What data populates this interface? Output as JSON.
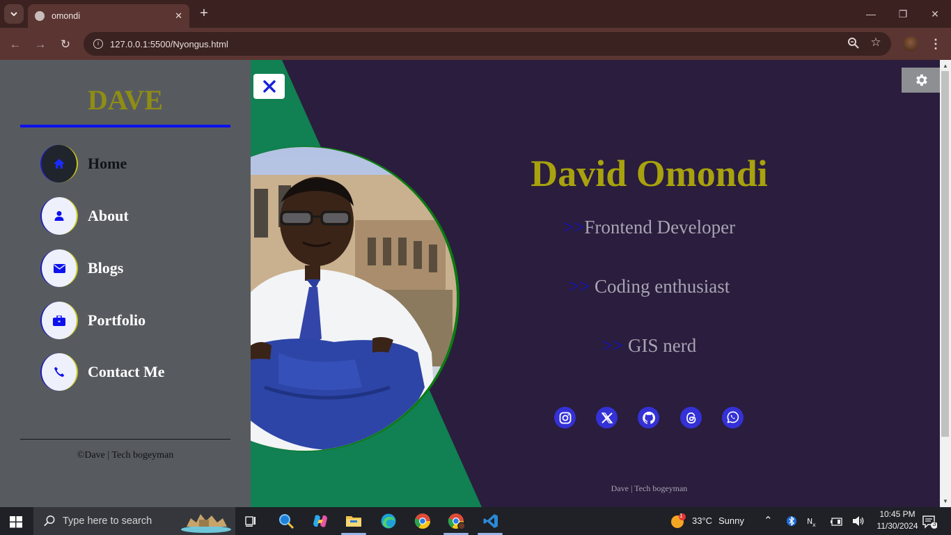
{
  "browser": {
    "tab_title": "omondi",
    "url": "127.0.0.1:5500/Nyongus.html"
  },
  "sidebar": {
    "brand": "DAVE",
    "items": [
      {
        "label": "Home",
        "icon": "home-icon",
        "active": true
      },
      {
        "label": "About",
        "icon": "user-icon"
      },
      {
        "label": "Blogs",
        "icon": "envelope-icon"
      },
      {
        "label": "Portfolio",
        "icon": "briefcase-icon"
      },
      {
        "label": "Contact Me",
        "icon": "phone-icon"
      }
    ],
    "footer": "©Dave | Tech bogeyman"
  },
  "hero": {
    "name": "David Omondi",
    "roles": [
      {
        "arrow": ">>",
        "text": "Frontend Developer"
      },
      {
        "arrow": ">>",
        "text": " Coding enthusiast"
      },
      {
        "arrow": ">>",
        "text": " GIS nerd"
      }
    ],
    "socials": [
      "instagram-icon",
      "x-twitter-icon",
      "github-icon",
      "threads-icon",
      "whatsapp-icon"
    ],
    "footer": "Dave | Tech bogeyman"
  },
  "colors": {
    "sidebar_bg": "#575b60",
    "hero_bg": "#2a1d3d",
    "accent_green": "#118052",
    "gold": "#a8a20e",
    "blue": "#0d11ee"
  },
  "taskbar": {
    "search_placeholder": "Type here to search",
    "weather_temp": "33°C",
    "weather_desc": "Sunny",
    "weather_badge": "1",
    "time": "10:45 PM",
    "date": "11/30/2024",
    "notifications": "3"
  }
}
